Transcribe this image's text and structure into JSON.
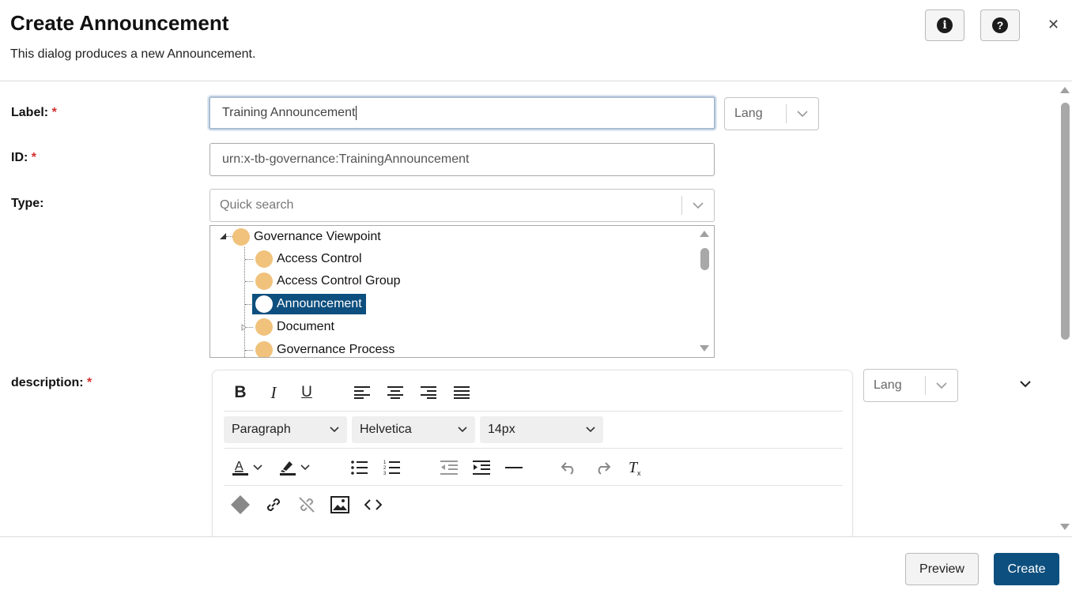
{
  "dialog": {
    "title": "Create Announcement",
    "subtitle": "This dialog produces a new Announcement.",
    "info_icon": "info-icon",
    "help_icon": "help-icon",
    "close_icon": "close-icon",
    "close_glyph": "✕"
  },
  "form": {
    "label": {
      "label": "Label:",
      "required_mark": "*",
      "value": "Training Announcement",
      "lang": "Lang"
    },
    "id": {
      "label": "ID:",
      "required_mark": "*",
      "value": "urn:x-tb-governance:TrainingAnnouncement"
    },
    "type": {
      "label": "Type:",
      "search_placeholder": "Quick search",
      "tree": {
        "root": "Governance Viewpoint",
        "children": [
          "Access Control",
          "Access Control Group",
          "Announcement",
          "Document",
          "Governance Process"
        ],
        "selected": "Announcement"
      }
    },
    "description": {
      "label": "description:",
      "required_mark": "*",
      "lang": "Lang",
      "toolbar": {
        "block_format": "Paragraph",
        "font_family": "Helvetica",
        "font_size": "14px"
      }
    }
  },
  "footer": {
    "preview_label": "Preview",
    "create_label": "Create"
  },
  "colors": {
    "primary": "#0d4f7e",
    "required": "#d32f2f",
    "tree_bullet": "#f0c27c"
  }
}
